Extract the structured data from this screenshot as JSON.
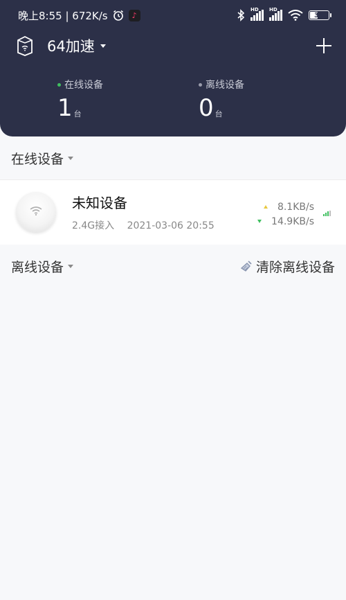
{
  "status_bar": {
    "time_speed": "晚上8:55 | 672K/s",
    "battery": "39",
    "signal_label_1": "HD",
    "signal_label_2": "HD"
  },
  "header": {
    "router_name": "64加速",
    "online_label": "在线设备",
    "online_count": "1",
    "online_unit": "台",
    "offline_label": "离线设备",
    "offline_count": "0",
    "offline_unit": "台"
  },
  "online_section": {
    "title": "在线设备"
  },
  "device": {
    "name": "未知设备",
    "band": "2.4G接入",
    "connected_time": "2021-03-06 20:55",
    "upload_speed": "8.1KB/s",
    "download_speed": "14.9KB/s"
  },
  "offline_section": {
    "title": "离线设备",
    "clear_label": "清除离线设备"
  },
  "colors": {
    "header_bg": "#2c3048",
    "online_dot": "#3fbf5f",
    "offline_dot": "#9a9cab",
    "upload_arrow": "#e8c840",
    "download_arrow": "#3fbf5f"
  }
}
